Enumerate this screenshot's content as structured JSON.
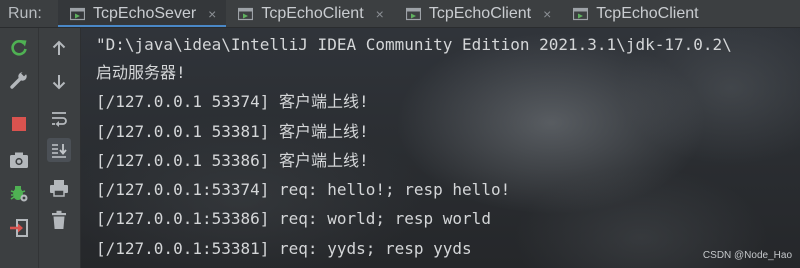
{
  "run_panel": {
    "label": "Run:",
    "tabs": [
      {
        "label": "TcpEchoSever",
        "active": true
      },
      {
        "label": "TcpEchoClient",
        "active": false
      },
      {
        "label": "TcpEchoClient",
        "active": false
      },
      {
        "label": "TcpEchoClient",
        "active": false
      }
    ],
    "close_glyph": "×"
  },
  "toolbar_left": [
    "rerun-icon",
    "wrench-icon",
    "stop-icon",
    "camera-icon",
    "debug-bug-icon",
    "exit-icon"
  ],
  "toolbar_right": [
    "arrow-up-icon",
    "arrow-down-icon",
    "soft-wrap-icon",
    "scroll-to-end-icon",
    "print-icon",
    "trash-icon"
  ],
  "console": {
    "lines": [
      "\"D:\\java\\idea\\IntelliJ IDEA Community Edition 2021.3.1\\jdk-17.0.2\\",
      "启动服务器!",
      "[/127.0.0.1 53374] 客户端上线!",
      "[/127.0.0.1 53381] 客户端上线!",
      "[/127.0.0.1 53386] 客户端上线!",
      "[/127.0.0.1:53374] req: hello!; resp hello!",
      "[/127.0.0.1:53386] req: world; resp world",
      "[/127.0.0.1:53381] req: yyds; resp yyds"
    ]
  },
  "watermark": "CSDN @Node_Hao",
  "colors": {
    "tab_active_underline": "#4a88c7",
    "rerun_green": "#4fb153",
    "stop_red": "#d9534f",
    "text": "#d4d6d8"
  }
}
